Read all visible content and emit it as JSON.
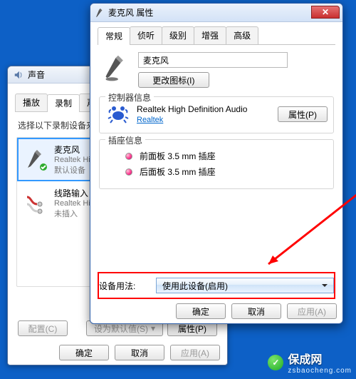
{
  "sound": {
    "title": "声音",
    "tabs": [
      "播放",
      "录制",
      "声音"
    ],
    "activeTabIndex": 1,
    "hint": "选择以下录制设备来修改设置:",
    "devices": [
      {
        "name": "麦克风",
        "sub": "Realtek Hig",
        "status": "默认设备",
        "selected": true,
        "icon": "mic"
      },
      {
        "name": "线路输入",
        "sub": "Realtek Hig",
        "status": "未插入",
        "selected": false,
        "icon": "line-in"
      }
    ],
    "buttons": {
      "config": "配置(C)",
      "setDefault": "设为默认值(S)",
      "props": "属性(P)",
      "ok": "确定",
      "cancel": "取消",
      "apply": "应用(A)"
    }
  },
  "prop": {
    "title": "麦克风 属性",
    "tabs": [
      "常规",
      "侦听",
      "级别",
      "增强",
      "高级"
    ],
    "activeTabIndex": 0,
    "nameField": "麦克风",
    "changeIcon": "更改图标(I)",
    "controllerGroup": {
      "legend": "控制器信息",
      "name": "Realtek High Definition Audio",
      "vendor": "Realtek",
      "propsBtn": "属性(P)"
    },
    "jackGroup": {
      "legend": "插座信息",
      "items": [
        "前面板 3.5 mm 插座",
        "后面板 3.5 mm 插座"
      ]
    },
    "usage": {
      "label": "设备用法:",
      "value": "使用此设备(启用)"
    },
    "footer": {
      "ok": "确定",
      "cancel": "取消",
      "apply": "应用(A)"
    }
  },
  "watermark": {
    "brand": "保成网",
    "url": "zsbaocheng.com",
    "mark": "✓"
  }
}
